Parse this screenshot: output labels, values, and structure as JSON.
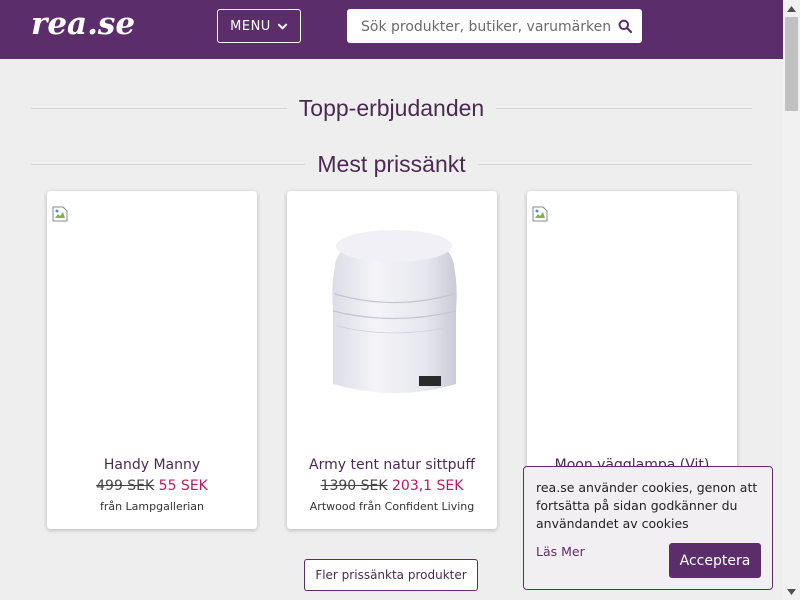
{
  "header": {
    "logo_text": "rea.se",
    "menu_label": "MENU",
    "search_placeholder": "Sök produkter, butiker, varumärken",
    "bg_color": "#5c2d6b"
  },
  "sections": {
    "top_offers": "Topp-erbjudanden",
    "most_reduced": "Mest prissänkt"
  },
  "products": [
    {
      "name": "Handy Manny",
      "old_price": "499 SEK",
      "new_price": "55 SEK",
      "store": "från Lampgallerian"
    },
    {
      "name": "Army tent natur sittpuff",
      "old_price": "1390 SEK",
      "new_price": "203,1 SEK",
      "store": "Artwood från Confident Living"
    },
    {
      "name": "Moon vägglampa (Vit)"
    }
  ],
  "more_button": "Fler prissänkta produkter",
  "cookie": {
    "message": "rea.se använder cookies, genon att fortsätta på sidan godkänner du användandet av cookies",
    "read_more": "Läs Mer",
    "accept": "Acceptera"
  }
}
